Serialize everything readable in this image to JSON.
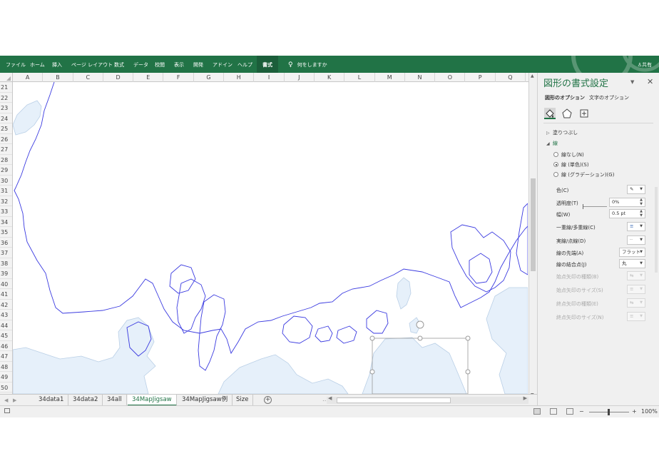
{
  "ribbon": {
    "tabs": [
      "ファイル",
      "ホーム",
      "挿入",
      "ページ レイアウト",
      "数式",
      "データ",
      "校閲",
      "表示",
      "開発",
      "アドイン",
      "ヘルプ"
    ],
    "active_tab": "書式",
    "tell_me": "何をしますか",
    "share": "共有",
    "color": "#217346"
  },
  "columns": [
    "A",
    "B",
    "C",
    "D",
    "E",
    "F",
    "G",
    "H",
    "I",
    "J",
    "K",
    "L",
    "M",
    "N",
    "O",
    "P",
    "Q"
  ],
  "rows": [
    "21",
    "22",
    "23",
    "24",
    "25",
    "26",
    "27",
    "28",
    "29",
    "30",
    "31",
    "32",
    "33",
    "34",
    "35",
    "36",
    "37",
    "38",
    "39",
    "40",
    "41",
    "42",
    "43",
    "44",
    "45",
    "46",
    "47",
    "48",
    "49",
    "50",
    "51"
  ],
  "sheets": {
    "tabs": [
      "34data1",
      "34data2",
      "34all",
      "34MapJigsaw",
      "34MapJigsaw例",
      "Size"
    ],
    "active": "34MapJigsaw",
    "more": "..."
  },
  "status": {
    "zoom": "100%",
    "minus": "−",
    "plus": "+"
  },
  "pane": {
    "title": "図形の書式設定",
    "subtabs": [
      "図形のオプション",
      "文字のオプション"
    ],
    "fill_section": "塗りつぶし",
    "line_section": "線",
    "radios": [
      {
        "label": "線なし(N)",
        "selected": false
      },
      {
        "label": "線 (単色)(S)",
        "selected": true
      },
      {
        "label": "線 (グラデーション)(G)",
        "selected": false
      }
    ],
    "props": {
      "color": "色(C)",
      "transparency": "透明度(T)",
      "transparency_value": "0%",
      "width": "幅(W)",
      "width_value": "0.5 pt",
      "compound": "一重線/多重線(C)",
      "dash": "実線/点線(D)",
      "cap": "線の先端(A)",
      "cap_value": "フラット",
      "join": "線の結合点(J)",
      "join_value": "丸",
      "begin_arrow_type": "始点矢印の種類(B)",
      "begin_arrow_size": "始点矢印のサイズ(S)",
      "end_arrow_type": "終点矢印の種類(E)",
      "end_arrow_size": "終点矢印のサイズ(N)"
    }
  },
  "map": {
    "line_color": "#3a3ae0",
    "land_fill": "#e6f0fa",
    "land_stroke": "#b9cfe6",
    "handle_color": "#9a9a9a"
  }
}
